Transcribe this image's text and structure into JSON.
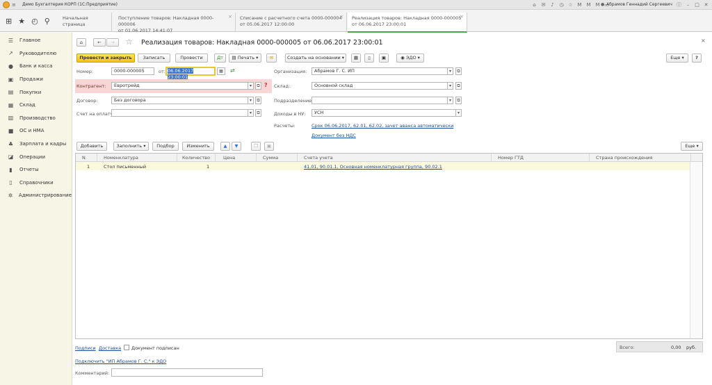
{
  "app_title": "Демо Бухгалтерия КОРП (1С:Предприятие)",
  "user_name": "Абрамов Геннадий Сергеевич",
  "tabs": [
    {
      "line1": "Начальная страница",
      "line2": ""
    },
    {
      "line1": "Поступление товаров: Накладная 0000-000006",
      "line2": "от 01.06.2017 14:41:07"
    },
    {
      "line1": "Списание с расчетного счета 0000-000004",
      "line2": "от 05.06.2017 12:00:00"
    },
    {
      "line1": "Реализация товаров: Накладная 0000-000005",
      "line2": "от 06.06.2017 23:00:01"
    }
  ],
  "sidebar": {
    "items": [
      {
        "label": "Главное",
        "icon": "menu-icon"
      },
      {
        "label": "Руководителю",
        "icon": "chart-up-icon"
      },
      {
        "label": "Банк и касса",
        "icon": "coin-icon"
      },
      {
        "label": "Продажи",
        "icon": "cart-icon"
      },
      {
        "label": "Покупки",
        "icon": "basket-icon"
      },
      {
        "label": "Склад",
        "icon": "warehouse-icon"
      },
      {
        "label": "Производство",
        "icon": "factory-icon"
      },
      {
        "label": "ОС и НМА",
        "icon": "truck-icon"
      },
      {
        "label": "Зарплата и кадры",
        "icon": "people-icon"
      },
      {
        "label": "Операции",
        "icon": "operations-icon"
      },
      {
        "label": "Отчеты",
        "icon": "report-icon"
      },
      {
        "label": "Справочники",
        "icon": "book-icon"
      },
      {
        "label": "Администрирование",
        "icon": "gear-icon"
      }
    ]
  },
  "doc": {
    "title": "Реализация товаров: Накладная 0000-000005 от 06.06.2017 23:00:01"
  },
  "toolbar": {
    "post_close": "Провести и закрыть",
    "save": "Записать",
    "post": "Провести",
    "print": "Печать",
    "create_based": "Создать на основании",
    "edo": "ЭДО",
    "more": "Еще",
    "help": "?"
  },
  "form": {
    "number_label": "Номер:",
    "number_value": "0000-000005",
    "from_label": "от:",
    "date_value": "06.06.2017 23:00:01",
    "org_label": "Организация:",
    "org_value": "Абрамов Г. С. ИП",
    "counterparty_label": "Контрагент:",
    "counterparty_value": "Евротрейд",
    "warehouse_label": "Склад:",
    "warehouse_value": "Основной склад",
    "contract_label": "Договор:",
    "contract_value": "Без договора",
    "department_label": "Подразделение:",
    "department_value": "",
    "invoice_label": "Счет на оплату:",
    "invoice_value": "",
    "income_label": "Доходы в НУ:",
    "income_value": "УСН",
    "settlements_label": "Расчеты:",
    "settlements_link": "Срок 06.06.2017, 62.01, 62.02, зачет аванса автоматически",
    "vat_link": "Документ без НДС"
  },
  "table_toolbar": {
    "add": "Добавить",
    "fill": "Заполнить",
    "select": "Подбор",
    "change": "Изменить",
    "more": "Еще"
  },
  "table": {
    "columns": [
      "N",
      "Номенклатура",
      "Количество",
      "Цена",
      "Сумма",
      "Счета учета",
      "Номер ГТД",
      "Страна происхождения"
    ],
    "rows": [
      {
        "n": "1",
        "item": "Стол письменный",
        "qty": "1",
        "price": "",
        "sum": "",
        "accounts": "41.01, 90.01.1, Основная номенклатурная группа, 90.02.1",
        "gtd": "",
        "country": ""
      }
    ]
  },
  "footer": {
    "signatures_link": "Подписи",
    "delivery_link": "Доставка",
    "signed_label": "Документ подписан",
    "connect_link": "Подключить \"ИП Абрамов Г. С.\" к ЭДО",
    "comment_label": "Комментарий:",
    "comment_value": "",
    "total_label": "Всего:",
    "total_value": "0,00",
    "currency": "руб."
  }
}
